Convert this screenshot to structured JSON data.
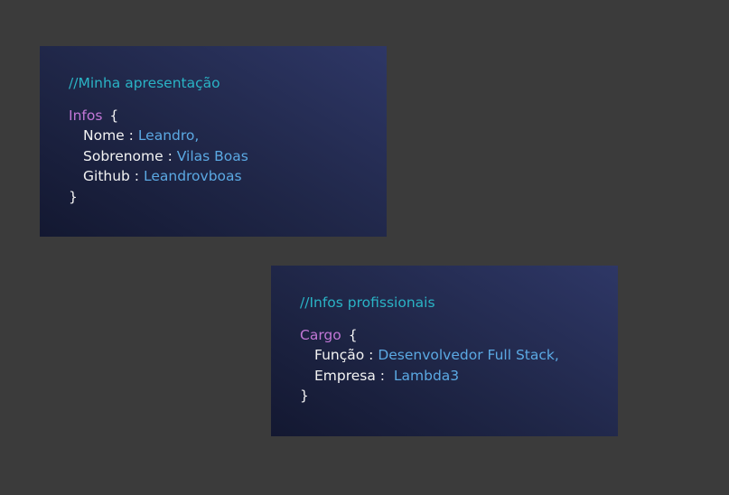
{
  "cards": [
    {
      "comment": "//Minha apresentação",
      "keyword": "Infos",
      "open_brace": "{",
      "close_brace": "}",
      "fields": [
        {
          "key": "Nome :",
          "value": "Leandro,"
        },
        {
          "key": "Sobrenome :",
          "value": "Vilas Boas"
        },
        {
          "key": "Github :",
          "value": "Leandrovboas"
        }
      ]
    },
    {
      "comment": "//Infos profissionais",
      "keyword": "Cargo",
      "open_brace": "{",
      "close_brace": "}",
      "fields": [
        {
          "key": "Função :",
          "value": "Desenvolvedor Full Stack,"
        },
        {
          "key": "Empresa :",
          "value": " Lambda3"
        }
      ]
    }
  ],
  "colors": {
    "background": "#3b3b3b",
    "card_gradient_start": "#131831",
    "card_gradient_end": "#2e3766",
    "comment": "#2ab3c5",
    "keyword": "#c277d6",
    "value": "#5ba9e3",
    "text": "#f3f3f3"
  }
}
